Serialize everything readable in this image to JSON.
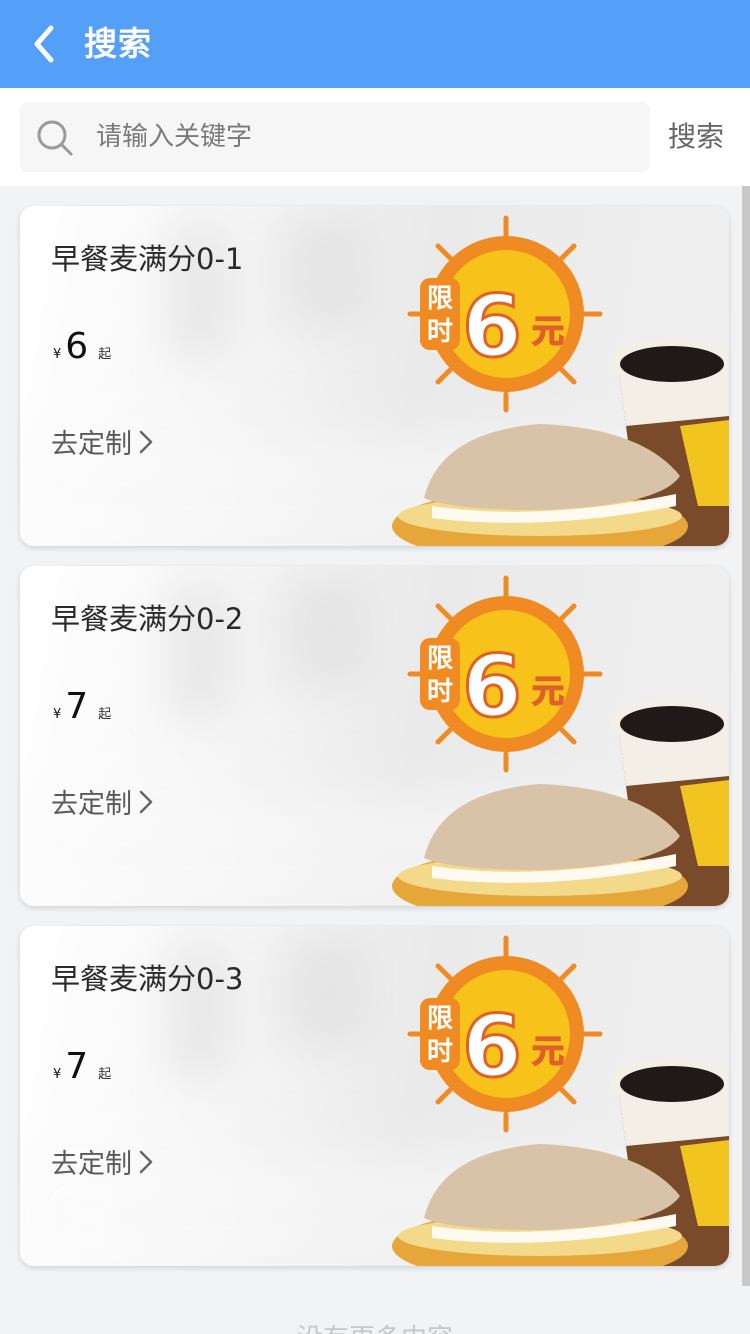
{
  "header": {
    "title": "搜索",
    "back_icon": "chevron-left-icon"
  },
  "search": {
    "placeholder": "请输入关键字",
    "value": "",
    "submit_label": "搜索",
    "icon": "search-icon"
  },
  "products": [
    {
      "name": "早餐麦满分0-1",
      "currency": "¥",
      "price": "6",
      "price_suffix": "起",
      "action_label": "去定制"
    },
    {
      "name": "早餐麦满分0-2",
      "currency": "¥",
      "price": "7",
      "price_suffix": "起",
      "action_label": "去定制"
    },
    {
      "name": "早餐麦满分0-3",
      "currency": "¥",
      "price": "7",
      "price_suffix": "起",
      "action_label": "去定制"
    }
  ],
  "promo_badge": {
    "line1": "限",
    "line2": "时",
    "amount": "6",
    "unit": "元"
  },
  "footer": {
    "text": "没有更多内容"
  },
  "colors": {
    "header": "#549ff8",
    "badge_orange": "#f08a22",
    "badge_yellow": "#f7c21a"
  }
}
